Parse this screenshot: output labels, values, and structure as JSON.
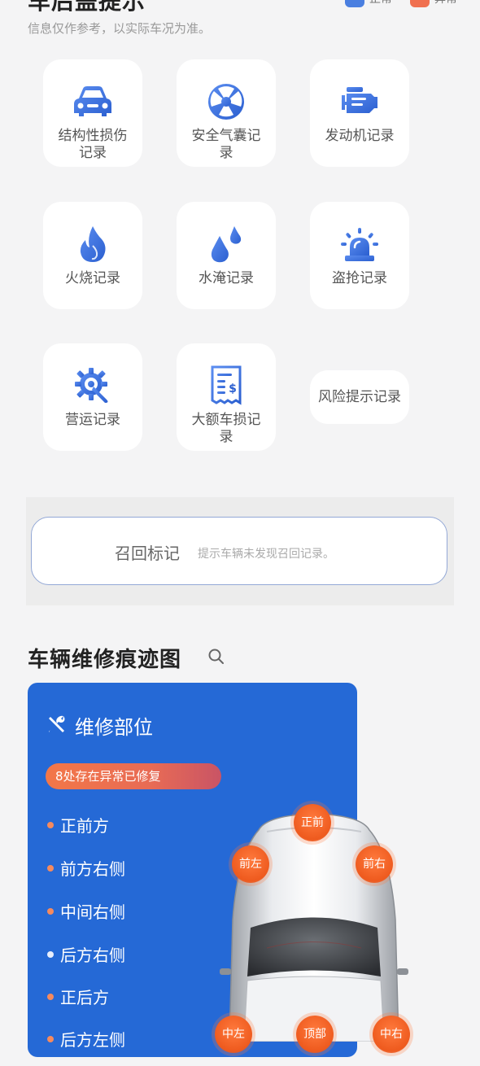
{
  "header": {
    "title": "车后盖提示",
    "legend": [
      {
        "label": "正常",
        "color": "#4a7fe0"
      },
      {
        "label": "异常",
        "color": "#f07050"
      }
    ],
    "subtitle": "信息仅作参考，以实际车况为准。"
  },
  "records": [
    {
      "label": "结构性损伤记录",
      "icon": "car-icon"
    },
    {
      "label": "安全气囊记录",
      "icon": "airbag-icon"
    },
    {
      "label": "发动机记录",
      "icon": "engine-icon"
    },
    {
      "label": "火烧记录",
      "icon": "fire-icon"
    },
    {
      "label": "水淹记录",
      "icon": "water-drops-icon"
    },
    {
      "label": "盗抢记录",
      "icon": "alarm-light-icon"
    },
    {
      "label": "营运记录",
      "icon": "gear-wrench-icon"
    },
    {
      "label": "大额车损记录",
      "icon": "receipt-icon"
    },
    {
      "label": "风险提示记录",
      "icon": ""
    }
  ],
  "recall": {
    "title": "召回标记",
    "desc": "提示车辆未发现召回记录。"
  },
  "repair_map": {
    "title": "车辆维修痕迹图",
    "panel_title": "维修部位",
    "badge": "8处存在异常已修复",
    "parts": [
      "正前方",
      "前方右侧",
      "中间右侧",
      "后方右侧",
      "正后方",
      "后方左侧"
    ],
    "pins": [
      "正前",
      "前左",
      "前右",
      "中左",
      "顶部",
      "中右"
    ]
  }
}
